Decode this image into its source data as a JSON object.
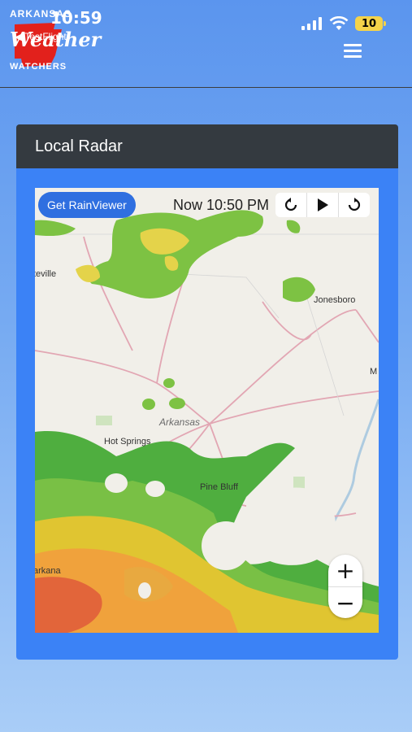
{
  "status": {
    "time": "10:59",
    "back_label": "◀ TestFlight",
    "battery": "10"
  },
  "header": {
    "logo_top": "ARKANSAS",
    "logo_script": "Weather",
    "logo_bottom": "WATCHERS",
    "menu_icon": "hamburger-icon"
  },
  "card": {
    "title": "Local Radar"
  },
  "map": {
    "rainviewer_label": "Get RainViewer",
    "time_label": "Now 10:50 PM",
    "controls": [
      "rewind-icon",
      "play-icon",
      "forward-icon"
    ],
    "zoom_in": "+",
    "zoom_out": "−",
    "cities": {
      "jonesboro": "Jonesboro",
      "hot_springs": "Hot Springs",
      "arkansas": "Arkansas",
      "pine_bluff": "Pine Bluff",
      "fayetteville": "teville",
      "texarkana": "arkana",
      "memphis": "M"
    }
  },
  "colors": {
    "header_blue": "#5b95ee",
    "card_blue": "#3b82f6",
    "card_header": "#343a40",
    "button_blue": "#2f6fe0"
  }
}
